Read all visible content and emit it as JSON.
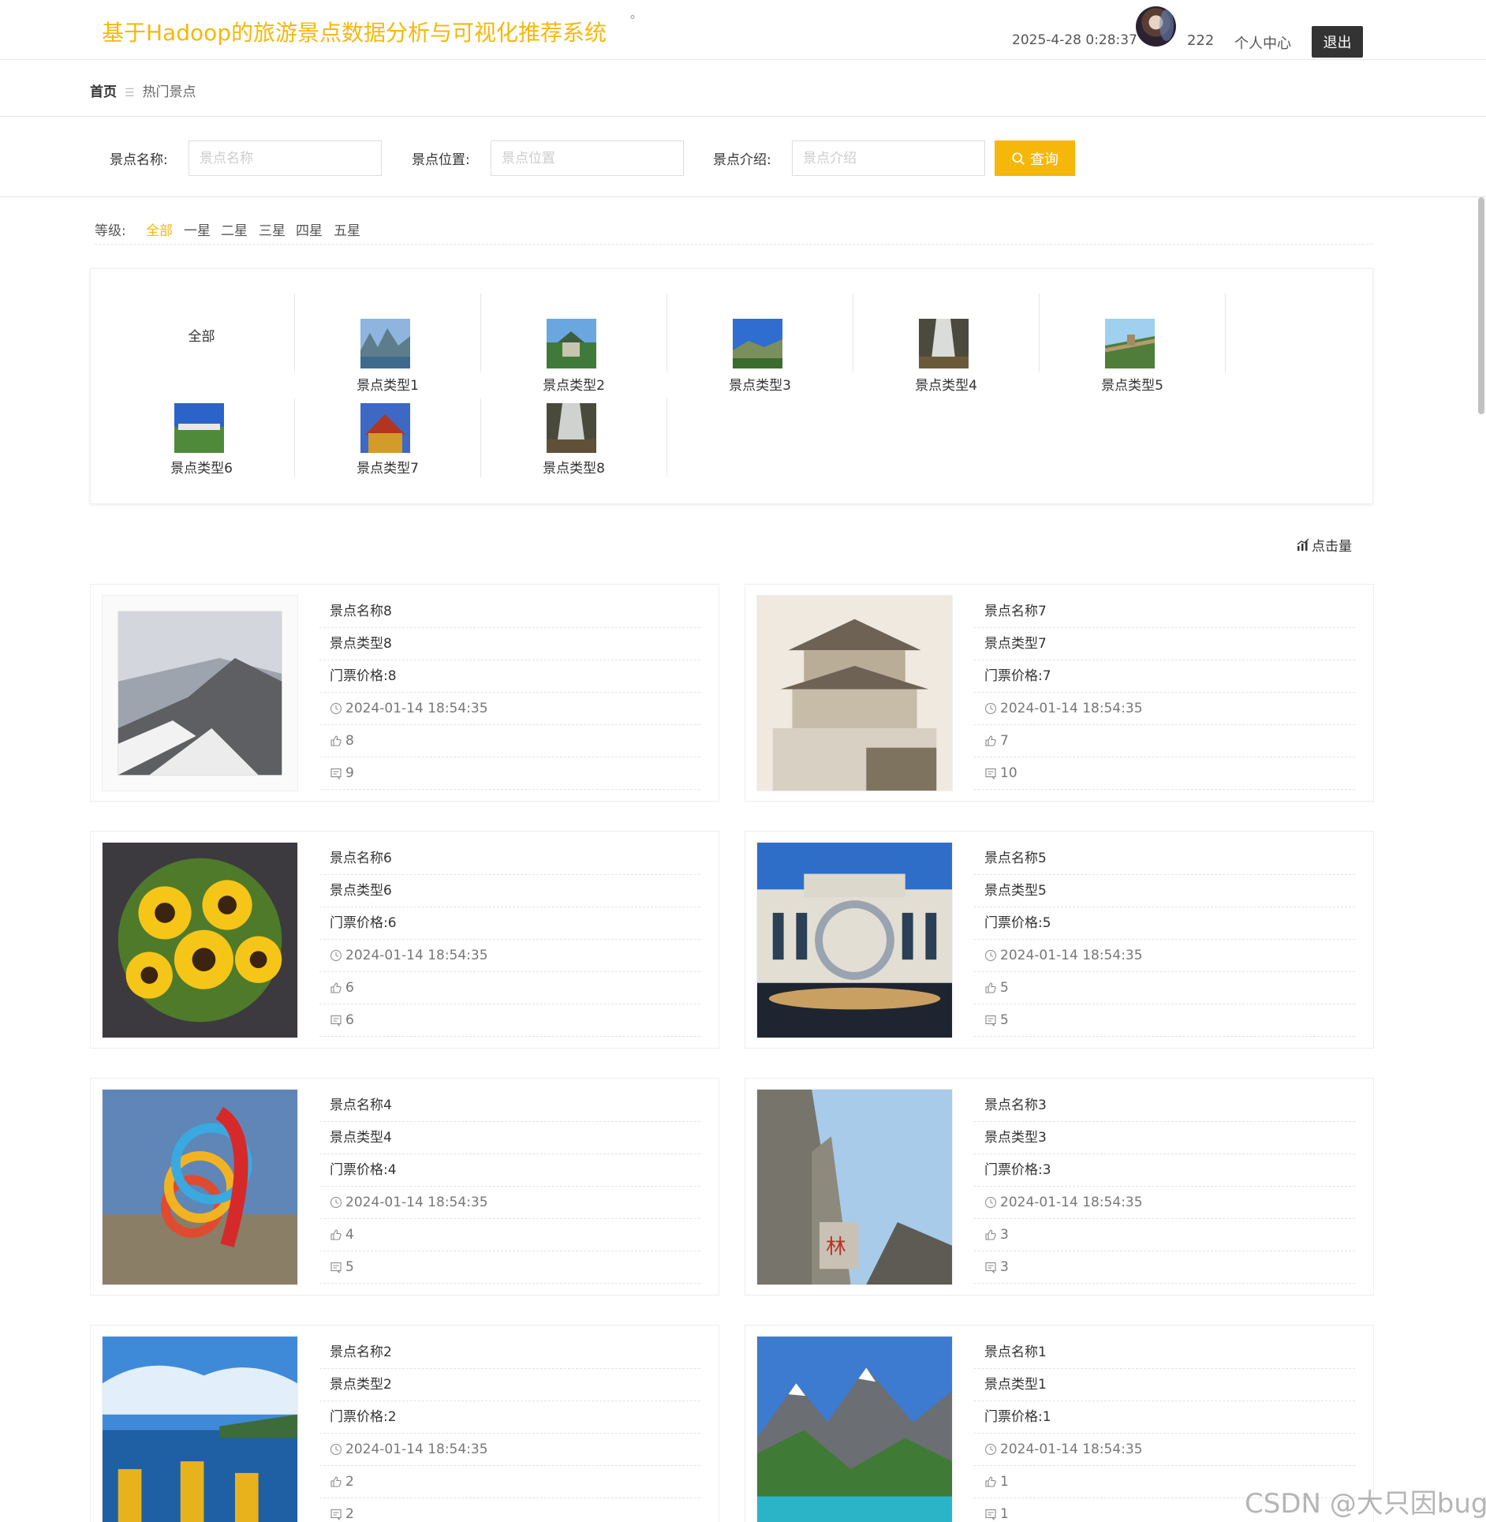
{
  "header": {
    "site_title": "基于Hadoop的旅游景点数据分析与可视化推荐系统",
    "title_dot": "°",
    "datetime": "2025-4-28 0:28:37",
    "username": "222",
    "user_center": "个人中心",
    "logout": "退出"
  },
  "breadcrumb": {
    "home": "首页",
    "sep": "☰",
    "current": "热门景点"
  },
  "search": {
    "name_label": "景点名称:",
    "name_placeholder": "景点名称",
    "location_label": "景点位置:",
    "location_placeholder": "景点位置",
    "intro_label": "景点介绍:",
    "intro_placeholder": "景点介绍",
    "query_button": "查询"
  },
  "levels": {
    "label": "等级:",
    "items": [
      "全部",
      "一星",
      "二星",
      "三星",
      "四星",
      "五星"
    ],
    "active": "全部"
  },
  "categories": {
    "all_label": "全部",
    "items": [
      "景点类型1",
      "景点类型2",
      "景点类型3",
      "景点类型4",
      "景点类型5",
      "景点类型6",
      "景点类型7",
      "景点类型8"
    ]
  },
  "sort": {
    "label": "点击量"
  },
  "spots": [
    {
      "name": "景点名称8",
      "type": "景点类型8",
      "price": "门票价格:8",
      "time": "2024-01-14 18:54:35",
      "likes": "8",
      "comments": "9",
      "img": "snowy-mountain"
    },
    {
      "name": "景点名称7",
      "type": "景点类型7",
      "price": "门票价格:7",
      "time": "2024-01-14 18:54:35",
      "likes": "7",
      "comments": "10",
      "img": "ancient-tower"
    },
    {
      "name": "景点名称6",
      "type": "景点类型6",
      "price": "门票价格:6",
      "time": "2024-01-14 18:54:35",
      "likes": "6",
      "comments": "6",
      "img": "sunflowers"
    },
    {
      "name": "景点名称5",
      "type": "景点类型5",
      "price": "门票价格:5",
      "time": "2024-01-14 18:54:35",
      "likes": "5",
      "comments": "5",
      "img": "modern-building"
    },
    {
      "name": "景点名称4",
      "type": "景点类型4",
      "price": "门票价格:4",
      "time": "2024-01-14 18:54:35",
      "likes": "4",
      "comments": "5",
      "img": "ring-sculpture"
    },
    {
      "name": "景点名称3",
      "type": "景点类型3",
      "price": "门票价格:3",
      "time": "2024-01-14 18:54:35",
      "likes": "3",
      "comments": "3",
      "img": "stone-forest"
    },
    {
      "name": "景点名称2",
      "type": "景点类型2",
      "price": "门票价格:2",
      "time": "2024-01-14 18:54:35",
      "likes": "2",
      "comments": "2",
      "img": "lake-boats"
    },
    {
      "name": "景点名称1",
      "type": "景点类型1",
      "price": "门票价格:1",
      "time": "2024-01-14 18:54:35",
      "likes": "1",
      "comments": "1",
      "img": "mountain-lake"
    }
  ],
  "watermark": "CSDN @大只因bug",
  "colors": {
    "accent": "#f5b80a",
    "dark_button": "#333333"
  }
}
